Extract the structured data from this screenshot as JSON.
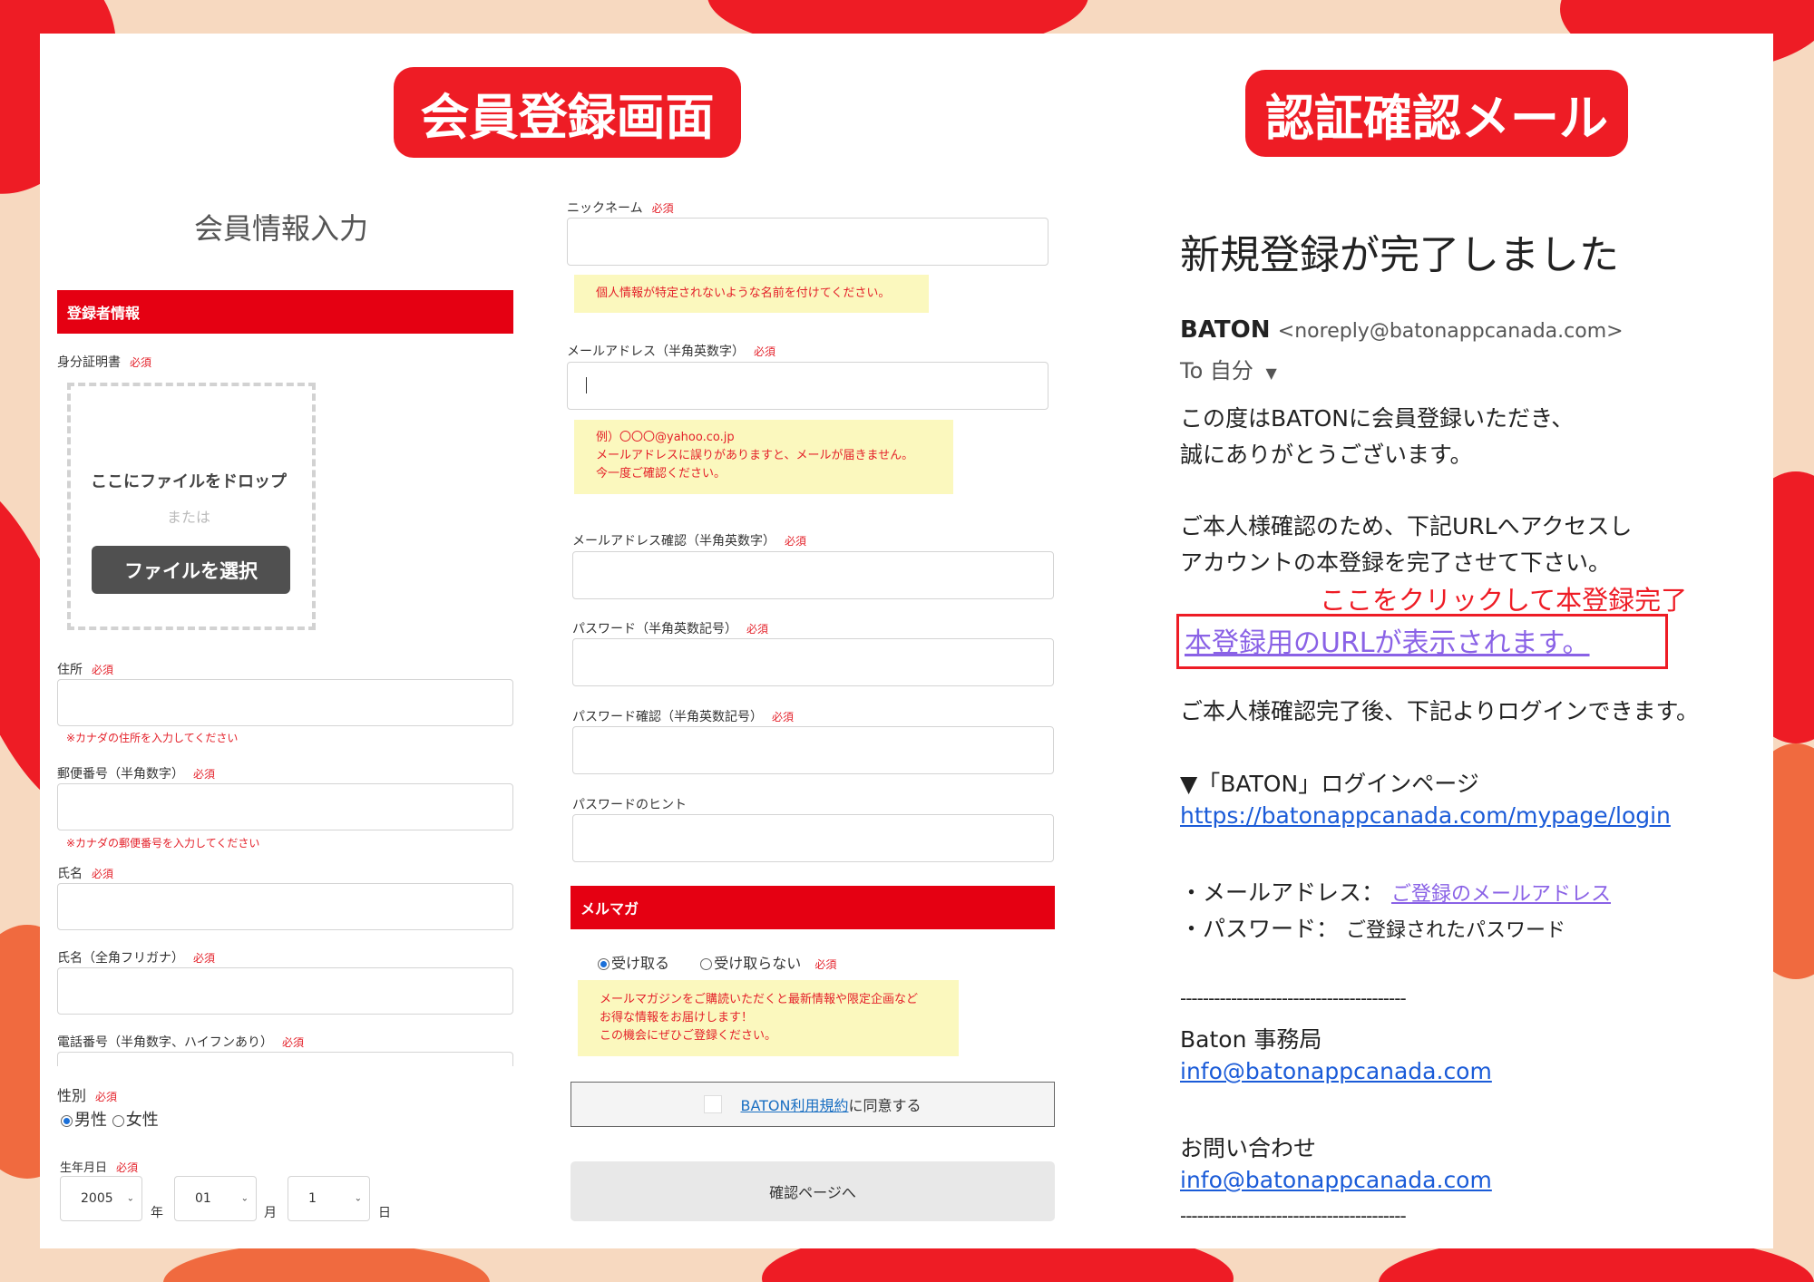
{
  "colors": {
    "accent": "#ee1c25",
    "bar": "#e50012",
    "note_bg": "#fbf8be",
    "link": "#1a5bd8",
    "link_visited": "#8a62e6"
  },
  "headers": {
    "left": "会員登録画面",
    "right": "認証確認メール"
  },
  "form": {
    "title": "会員情報入力",
    "section_registrant": "登録者情報",
    "required": "必須",
    "id_doc_label": "身分証明書",
    "drop_text": "ここにファイルをドロップ",
    "or_text": "または",
    "file_button": "ファイルを選択",
    "address_label": "住所",
    "address_hint": "※カナダの住所を入力してください",
    "postal_label": "郵便番号（半角数字）",
    "postal_hint": "※カナダの郵便番号を入力してください",
    "name_label": "氏名",
    "kana_label": "氏名（全角フリガナ）",
    "phone_label": "電話番号（半角数字、ハイフンあり）",
    "gender_label": "性別",
    "gender_male": "男性",
    "gender_female": "女性",
    "birth_label": "生年月日",
    "birth_year": "2005",
    "birth_month": "01",
    "birth_day": "1",
    "year_unit": "年",
    "month_unit": "月",
    "day_unit": "日",
    "nickname_label": "ニックネーム",
    "nickname_note": "個人情報が特定されないような名前を付けてください。",
    "email_label": "メールアドレス（半角英数字）",
    "email_note_1": "例）〇〇〇@yahoo.co.jp",
    "email_note_2": "メールアドレスに誤りがありますと、メールが届きません。",
    "email_note_3": "今一度ご確認ください。",
    "email_confirm_label": "メールアドレス確認（半角英数字）",
    "password_label": "パスワード（半角英数記号）",
    "password_confirm_label": "パスワード確認（半角英数記号）",
    "password_hint_label": "パスワードのヒント",
    "section_newsletter": "メルマガ",
    "receive": "受け取る",
    "not_receive": "受け取らない",
    "newsletter_note_1": "メールマガジンをご購読いただくと最新情報や限定企画など",
    "newsletter_note_2": "お得な情報をお届けします！",
    "newsletter_note_3": "この機会にぜひご登録ください。",
    "terms_link": "BATON利用規約",
    "terms_suffix": "に同意する",
    "confirm_button": "確認ページへ"
  },
  "mail": {
    "title": "新規登録が完了しました",
    "sender_name": "BATON",
    "sender_email": "<noreply@batonappcanada.com>",
    "to": "To 自分",
    "p1_l1": "この度はBATONに会員登録いただき、",
    "p1_l2": "誠にありがとうございます。",
    "p2_l1": "ご本人様確認のため、下記URLへアクセスし",
    "p2_l2": "アカウントの本登録を完了させて下さい。",
    "annotation": "ここをクリックして本登録完了",
    "url_placeholder": "本登録用のURLが表示されます。",
    "p3": "ご本人様確認完了後、下記よりログインできます。",
    "login_heading": "▼「BATON」ログインページ",
    "login_url": "https://batonappcanada.com/mypage/login",
    "email_row_label": "・メールアドレス：",
    "email_row_value": "ご登録のメールアドレス",
    "password_row_label": "・パスワード：",
    "password_row_value": "ご登録されたパスワード",
    "divider": "----------------------------------------",
    "office": "Baton 事務局",
    "office_email": "info@batonappcanada.com",
    "contact": "お問い合わせ",
    "contact_email": "info@batonappcanada.com"
  }
}
